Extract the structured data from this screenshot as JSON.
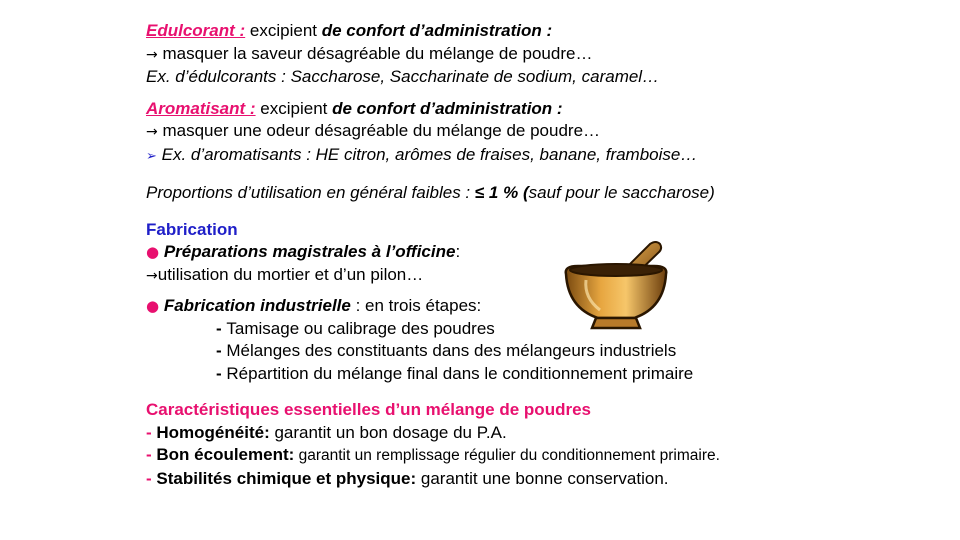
{
  "s1": {
    "term": "Edulcorant :",
    "role_pre": " excipient ",
    "role_bold": " de confort d’administration :",
    "arrow": "→",
    "action": " masquer la saveur désagréable du mélange de poudre…",
    "examples": "Ex. d’édulcorants : Saccharose, Saccharinate de sodium, caramel…"
  },
  "s2": {
    "term": "Aromatisant :",
    "role_pre": " excipient ",
    "role_bold": " de confort d’administration :",
    "arrow": "→",
    "action": " masquer une odeur désagréable du mélange de poudre…",
    "bullet": "➢",
    "examples": " Ex. d’aromatisants : HE citron, arômes de fraises, banane, framboise…"
  },
  "s3": {
    "pre": "Proportions d’utilisation en général faibles : ",
    "bold": "≤ 1 % (",
    "post": "sauf pour le saccharose)"
  },
  "s4": {
    "heading": "Fabrication",
    "bullet": "●",
    "item1_bold": " Préparations magistrales à l’officine",
    "item1_post": ":",
    "arrow": "→",
    "item1_detail": "utilisation du mortier et d’un pilon…",
    "item2_bold": " Fabrication industrielle",
    "item2_post": " : en trois étapes:",
    "steps": [
      {
        "dash": "- ",
        "text": "Tamisage ou calibrage des poudres"
      },
      {
        "dash": "- ",
        "text": "Mélanges des constituants dans des mélangeurs industriels"
      },
      {
        "dash": "- ",
        "text": "Répartition du mélange final dans le conditionnement  primaire"
      }
    ]
  },
  "s5": {
    "heading": "Caractéristiques essentielles d’un mélange de poudres",
    "items": [
      {
        "dash": "- ",
        "label": "Homogénéité:",
        "text": " garantit un bon dosage du P.A."
      },
      {
        "dash": "- ",
        "label": "Bon écoulement:",
        "text": " garantit un remplissage régulier du conditionnement primaire."
      },
      {
        "dash": "- ",
        "label": "Stabilités chimique  et physique:",
        "text": " garantit une bonne conservation."
      }
    ]
  },
  "colors": {
    "accent_pink": "#e8106f",
    "accent_blue": "#1f1fc8"
  },
  "image": {
    "icon": "mortar-and-pestle-icon"
  }
}
